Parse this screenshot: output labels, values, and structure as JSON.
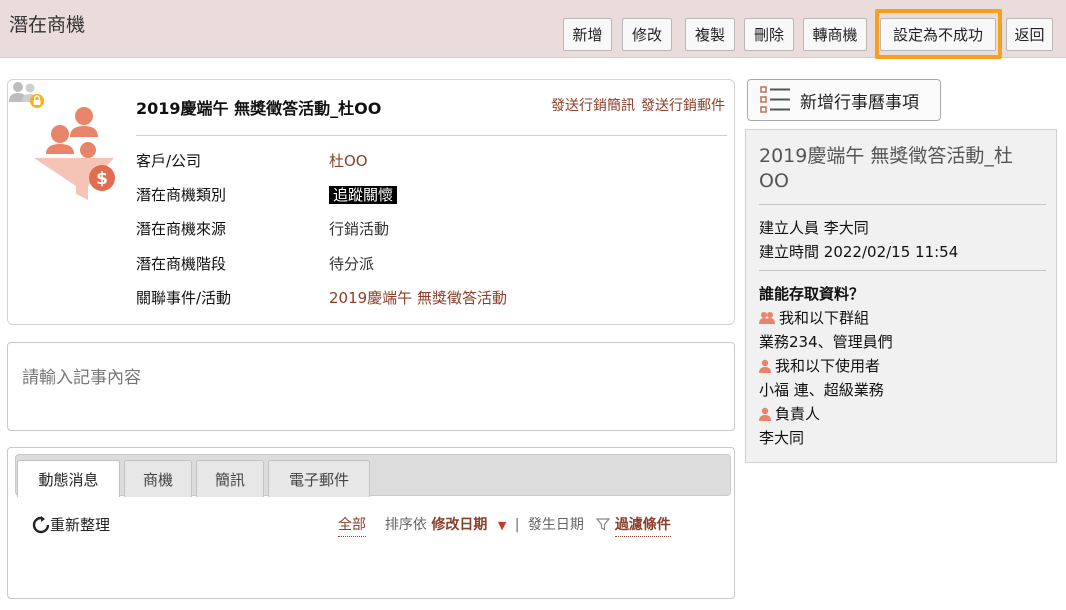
{
  "header": {
    "title": "潛在商機",
    "buttons": {
      "new": "新增",
      "edit": "修改",
      "copy": "複製",
      "delete": "刪除",
      "convert": "轉商機",
      "set_failed": "設定為不成功",
      "back": "返回"
    }
  },
  "lead": {
    "title": "2019慶端午 無獎徵答活動_杜OO",
    "actions": {
      "send_sms": "發送行銷簡訊",
      "send_email": "發送行銷郵件"
    },
    "fields": [
      {
        "label": "客戶/公司",
        "value": "杜OO"
      },
      {
        "label": "潛在商機類別",
        "value": "追蹤關懷"
      },
      {
        "label": "潛在商機來源",
        "value": "行銷活動"
      },
      {
        "label": "潛在商機階段",
        "value": "待分派"
      },
      {
        "label": "關聯事件/活動",
        "value": "2019慶端午 無獎徵答活動"
      }
    ]
  },
  "note": {
    "placeholder": "請輸入記事內容"
  },
  "activity": {
    "tabs": [
      "動態消息",
      "商機",
      "簡訊",
      "電子郵件"
    ],
    "active_tab": "動態消息",
    "refresh_label": "重新整理",
    "filter": {
      "all": "全部",
      "sort_by": "排序依",
      "modified_date": "修改日期",
      "separator": "|",
      "occurred_date": "發生日期",
      "filter_conditions": "過濾條件"
    }
  },
  "sidebar": {
    "add_event_label": "新增行事曆事項",
    "title": "2019慶端午 無獎徵答活動_杜OO",
    "creator_label": "建立人員",
    "creator": "李大同",
    "created_time_label": "建立時間",
    "created_time": "2022/02/15 11:54",
    "access_heading": "誰能存取資料？",
    "groups_label": "我和以下群組",
    "groups": "業務234、管理員們",
    "users_label": "我和以下使用者",
    "users": "小福 連、超級業務",
    "owner_label": "負責人",
    "owner": "李大同"
  },
  "colors": {
    "header_bg": "#ebdcdc",
    "link": "#8a3f2a",
    "highlight": "#f5a01e",
    "icon_orange": "#e8846a"
  }
}
